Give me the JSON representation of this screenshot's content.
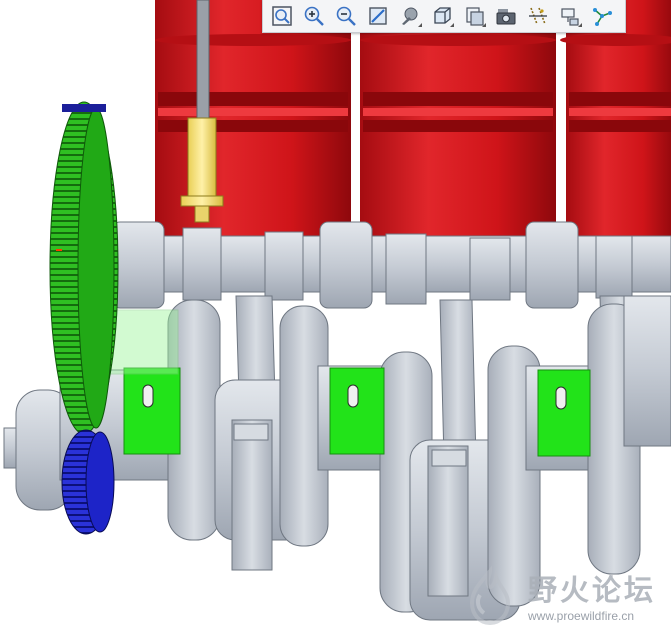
{
  "colors": {
    "cylinder_red": "#d9191e",
    "shaft_gray": "#c3c9d2",
    "gear_green": "#27b21b",
    "gear_blue": "#1c22c4",
    "bearing_green": "#25e61c",
    "injector_yellow": "#fde886"
  },
  "toolbar": {
    "buttons": [
      {
        "name": "zoom-fit-icon",
        "label": ""
      },
      {
        "name": "zoom-in-icon",
        "label": ""
      },
      {
        "name": "zoom-out-icon",
        "label": ""
      },
      {
        "name": "repaint-icon",
        "label": ""
      },
      {
        "name": "display-style-icon",
        "label": ""
      },
      {
        "name": "saved-views-icon",
        "label": ""
      },
      {
        "name": "view-manager-icon",
        "label": ""
      },
      {
        "name": "camera-icon",
        "label": ""
      },
      {
        "name": "datum-display-icon",
        "label": ""
      },
      {
        "name": "annotation-icon",
        "label": ""
      },
      {
        "name": "spin-center-icon",
        "label": ""
      }
    ]
  },
  "watermark": {
    "title": "野火论坛",
    "url": "www.proewildfire.cn"
  }
}
